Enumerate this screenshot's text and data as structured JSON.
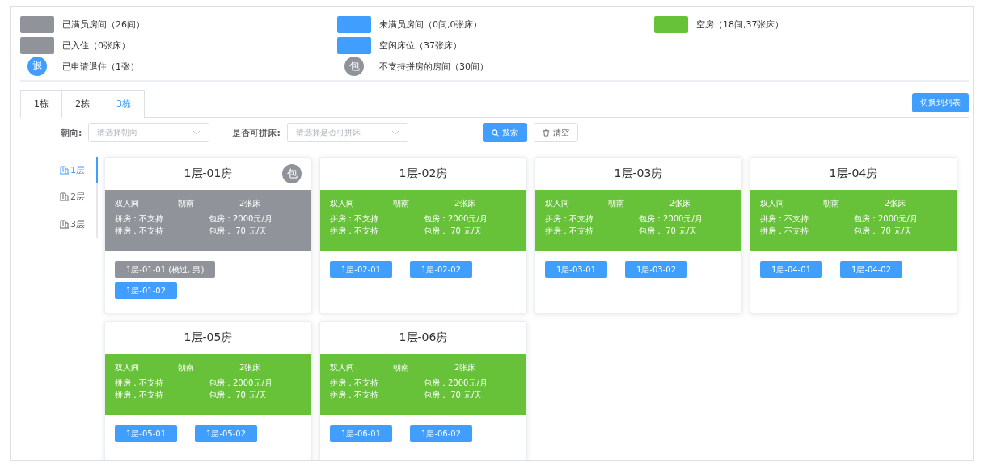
{
  "legend": [
    [
      {
        "kind": "swatch",
        "color": "#909399",
        "label": "已满员房间（26间）"
      },
      {
        "kind": "swatch",
        "color": "#909399",
        "label": "已入住（0张床）"
      },
      {
        "kind": "badge",
        "color": "#409eff",
        "symbol": "退",
        "label": "已申请退住（1张）"
      }
    ],
    [
      {
        "kind": "swatch",
        "color": "#409eff",
        "label": "未满员房间（0间,0张床）"
      },
      {
        "kind": "swatch",
        "color": "#409eff",
        "label": "空闲床位（37张床）"
      },
      {
        "kind": "badge",
        "color": "#909399",
        "symbol": "包",
        "label": "不支持拼房的房间（30间）"
      }
    ],
    [
      {
        "kind": "swatch",
        "color": "#67c23a",
        "label": "空房（18间,37张床）"
      }
    ]
  ],
  "tabs": [
    {
      "label": "1栋",
      "selected": false
    },
    {
      "label": "2栋",
      "selected": false
    },
    {
      "label": "3栋",
      "selected": true
    }
  ],
  "switch_button": "切换到列表",
  "filters": [
    {
      "label": "朝向:",
      "placeholder": "请选择朝向"
    },
    {
      "label": "是否可拼床:",
      "placeholder": "请选择是否可拼床"
    }
  ],
  "search_button": "搜索",
  "clear_button": "清空",
  "floors": [
    {
      "label": "1层",
      "selected": true
    },
    {
      "label": "2层",
      "selected": false
    },
    {
      "label": "3层",
      "selected": false
    }
  ],
  "rooms": [
    {
      "title": "1层-01房",
      "color": "#909399",
      "badge": "包",
      "info": [
        "双人间",
        "朝南",
        "2张床"
      ],
      "lines": [
        [
          "拼房：不支持",
          "包房：2000元/月"
        ],
        [
          "拼房：不支持",
          "包房： 70 元/天"
        ]
      ],
      "beds": [
        {
          "label": "1层-01-01 (杨过, 男)",
          "occupied": true
        },
        {
          "label": "1层-01-02",
          "occupied": false
        }
      ]
    },
    {
      "title": "1层-02房",
      "color": "#67c23a",
      "info": [
        "双人间",
        "朝南",
        "2张床"
      ],
      "lines": [
        [
          "拼房：不支持",
          "包房：2000元/月"
        ],
        [
          "拼房：不支持",
          "包房： 70 元/天"
        ]
      ],
      "beds": [
        {
          "label": "1层-02-01",
          "occupied": false
        },
        {
          "label": "1层-02-02",
          "occupied": false
        }
      ]
    },
    {
      "title": "1层-03房",
      "color": "#67c23a",
      "info": [
        "双人间",
        "朝南",
        "2张床"
      ],
      "lines": [
        [
          "拼房：不支持",
          "包房：2000元/月"
        ],
        [
          "拼房：不支持",
          "包房： 70 元/天"
        ]
      ],
      "beds": [
        {
          "label": "1层-03-01",
          "occupied": false
        },
        {
          "label": "1层-03-02",
          "occupied": false
        }
      ]
    },
    {
      "title": "1层-04房",
      "color": "#67c23a",
      "info": [
        "双人间",
        "朝南",
        "2张床"
      ],
      "lines": [
        [
          "拼房：不支持",
          "包房：2000元/月"
        ],
        [
          "拼房：不支持",
          "包房： 70 元/天"
        ]
      ],
      "beds": [
        {
          "label": "1层-04-01",
          "occupied": false
        },
        {
          "label": "1层-04-02",
          "occupied": false
        }
      ]
    },
    {
      "title": "1层-05房",
      "color": "#67c23a",
      "info": [
        "双人间",
        "朝南",
        "2张床"
      ],
      "lines": [
        [
          "拼房：不支持",
          "包房：2000元/月"
        ],
        [
          "拼房：不支持",
          "包房： 70 元/天"
        ]
      ],
      "beds": [
        {
          "label": "1层-05-01",
          "occupied": false
        },
        {
          "label": "1层-05-02",
          "occupied": false
        }
      ]
    },
    {
      "title": "1层-06房",
      "color": "#67c23a",
      "info": [
        "双人间",
        "朝南",
        "2张床"
      ],
      "lines": [
        [
          "拼房：不支持",
          "包房：2000元/月"
        ],
        [
          "拼房：不支持",
          "包房： 70 元/天"
        ]
      ],
      "beds": [
        {
          "label": "1层-06-01",
          "occupied": false
        },
        {
          "label": "1层-06-02",
          "occupied": false
        }
      ]
    }
  ]
}
